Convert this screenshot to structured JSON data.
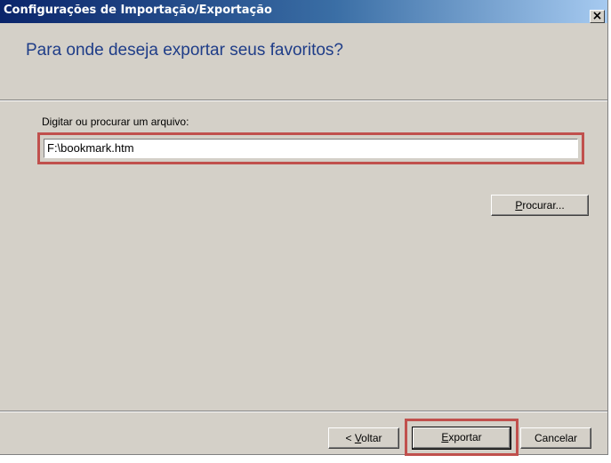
{
  "window": {
    "title": "Configurações de Importação/Exportação",
    "close_label": "×"
  },
  "header": {
    "heading": "Para onde deseja exportar seus favoritos?"
  },
  "form": {
    "label": "Digitar ou procurar um arquivo:",
    "file_path": "F:\\bookmark.htm",
    "browse_button": {
      "mnemonic": "P",
      "rest": "rocurar..."
    }
  },
  "footer": {
    "back_button": {
      "prefix": "< ",
      "mnemonic": "V",
      "rest": "oltar"
    },
    "export_button": {
      "mnemonic": "E",
      "rest": "xportar"
    },
    "cancel_button": "Cancelar"
  },
  "colors": {
    "highlight": "#c0504d",
    "heading": "#1f3d88",
    "titlebar": "#0a246a",
    "dialog": "#d4d0c8"
  }
}
